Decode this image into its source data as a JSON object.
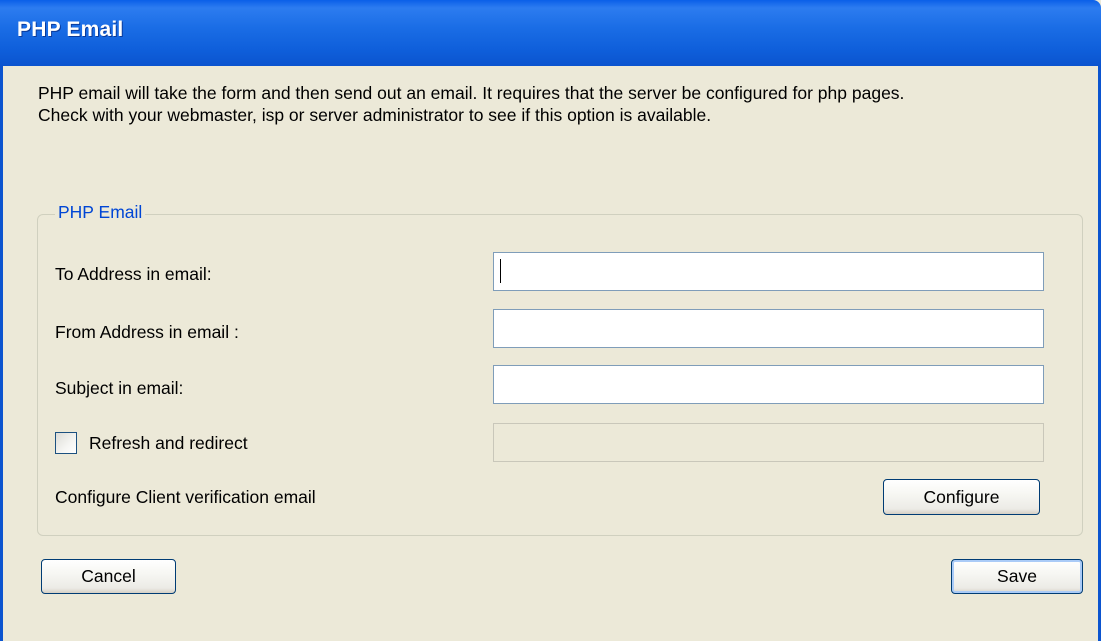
{
  "window": {
    "title": "PHP Email"
  },
  "description": {
    "line1": "PHP email will take the form and then send out an email. It requires that the server be configured for php pages.",
    "line2": " Check with your webmaster, isp or server administrator to see if this option is available."
  },
  "group": {
    "legend": "PHP Email",
    "to_label": "To Address in email:",
    "to_value": "",
    "from_label": "From Address in email :",
    "from_value": "",
    "subject_label": "Subject in email:",
    "subject_value": "",
    "refresh_label": "Refresh and redirect",
    "refresh_checked": false,
    "refresh_value": "",
    "configure_label": "Configure Client verification email",
    "configure_button": "Configure"
  },
  "footer": {
    "cancel_button": "Cancel",
    "save_button": "Save"
  },
  "colors": {
    "titlebar": "#0b54cf",
    "window_bg": "#ece9d8",
    "legend_text": "#0046d5",
    "button_border": "#003c74"
  }
}
